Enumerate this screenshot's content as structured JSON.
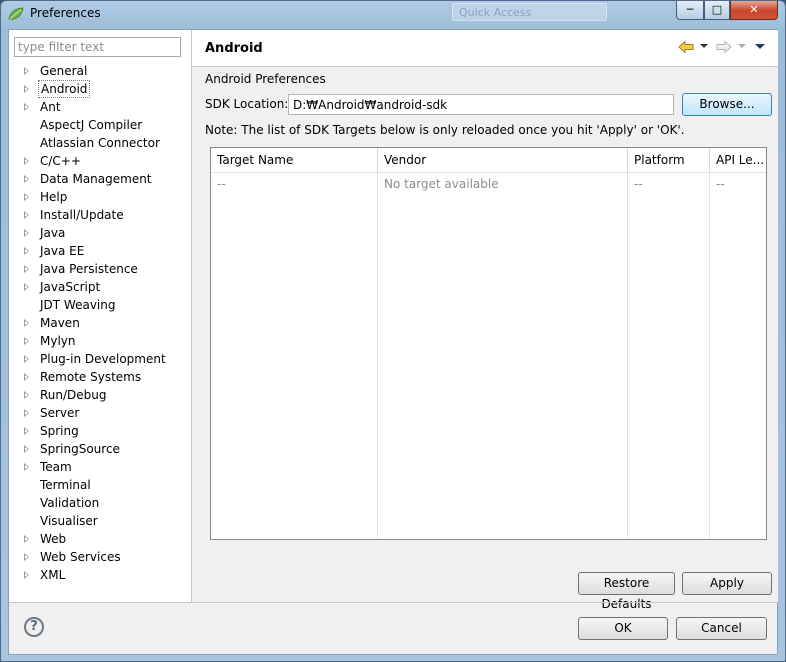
{
  "window": {
    "title": "Preferences",
    "quick_access_placeholder": "Quick Access",
    "minimize_label": "─",
    "maximize_label": "□",
    "close_label": "✕"
  },
  "filter": {
    "placeholder": "type filter text",
    "value": ""
  },
  "tree": {
    "items": [
      {
        "label": "General",
        "expandable": true
      },
      {
        "label": "Android",
        "expandable": true,
        "selected": true
      },
      {
        "label": "Ant",
        "expandable": true
      },
      {
        "label": "AspectJ Compiler",
        "expandable": false
      },
      {
        "label": "Atlassian Connector",
        "expandable": false
      },
      {
        "label": "C/C++",
        "expandable": true
      },
      {
        "label": "Data Management",
        "expandable": true
      },
      {
        "label": "Help",
        "expandable": true
      },
      {
        "label": "Install/Update",
        "expandable": true
      },
      {
        "label": "Java",
        "expandable": true
      },
      {
        "label": "Java EE",
        "expandable": true
      },
      {
        "label": "Java Persistence",
        "expandable": true
      },
      {
        "label": "JavaScript",
        "expandable": true
      },
      {
        "label": "JDT Weaving",
        "expandable": false
      },
      {
        "label": "Maven",
        "expandable": true
      },
      {
        "label": "Mylyn",
        "expandable": true
      },
      {
        "label": "Plug-in Development",
        "expandable": true
      },
      {
        "label": "Remote Systems",
        "expandable": true
      },
      {
        "label": "Run/Debug",
        "expandable": true
      },
      {
        "label": "Server",
        "expandable": true
      },
      {
        "label": "Spring",
        "expandable": true
      },
      {
        "label": "SpringSource",
        "expandable": true
      },
      {
        "label": "Team",
        "expandable": true
      },
      {
        "label": "Terminal",
        "expandable": false
      },
      {
        "label": "Validation",
        "expandable": false
      },
      {
        "label": "Visualiser",
        "expandable": false
      },
      {
        "label": "Web",
        "expandable": true
      },
      {
        "label": "Web Services",
        "expandable": true
      },
      {
        "label": "XML",
        "expandable": true
      }
    ]
  },
  "page": {
    "title": "Android",
    "section_label": "Android Preferences",
    "sdk_label": "SDK Location:",
    "sdk_value": "D:₩Android₩android-sdk",
    "browse_label": "Browse...",
    "note": "Note: The list of SDK Targets below is only reloaded once you hit 'Apply' or 'OK'."
  },
  "table": {
    "columns": [
      "Target Name",
      "Vendor",
      "Platform",
      "API Le..."
    ],
    "rows": [
      [
        "--",
        "No target available",
        "--",
        "--"
      ]
    ]
  },
  "buttons": {
    "restore_defaults": "Restore Defaults",
    "apply": "Apply",
    "ok": "OK",
    "cancel": "Cancel",
    "help": "?"
  },
  "colors": {
    "accent": "#3c7fb1",
    "nav_back": "#e8a72a"
  }
}
